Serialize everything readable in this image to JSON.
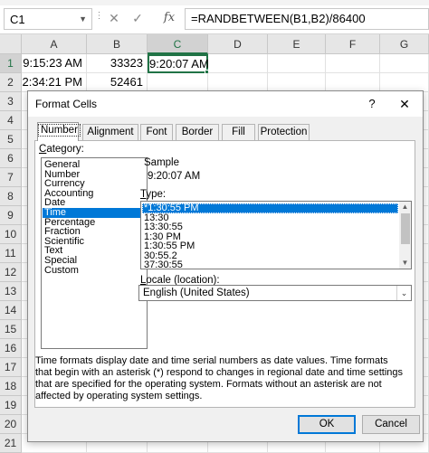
{
  "formula_bar": {
    "name_box": "C1",
    "dots": "⋮",
    "cancel_icon": "✕",
    "enter_icon": "✓",
    "fx_icon": "fx",
    "formula": "=RANDBETWEEN(B1,B2)/86400"
  },
  "sheet": {
    "columns": [
      "A",
      "B",
      "C",
      "D",
      "E",
      "F",
      "G"
    ],
    "active_column": "C",
    "rows": [
      "1",
      "2",
      "3",
      "4",
      "5",
      "6",
      "7",
      "8",
      "9",
      "10",
      "11",
      "12",
      "13",
      "14",
      "15",
      "16",
      "17",
      "18",
      "19",
      "20",
      "21"
    ],
    "active_row": "1",
    "cells": {
      "A1": "9:15:23 AM",
      "B1": "33323",
      "C1": "9:20:07 AM",
      "A2": "2:34:21 PM",
      "B2": "52461"
    },
    "accent_color": "#217346"
  },
  "dialog": {
    "title": "Format Cells",
    "help_label": "?",
    "close_icon": "✕",
    "tabs": [
      "Number",
      "Alignment",
      "Font",
      "Border",
      "Fill",
      "Protection"
    ],
    "active_tab": "Number",
    "category_label_pre": "",
    "category_label_key": "C",
    "category_label_post": "ategory:",
    "categories": [
      "General",
      "Number",
      "Currency",
      "Accounting",
      "Date",
      "Time",
      "Percentage",
      "Fraction",
      "Scientific",
      "Text",
      "Special",
      "Custom"
    ],
    "selected_category": "Time",
    "sample_label": "Sample",
    "sample_value": "9:20:07 AM",
    "type_label_key": "T",
    "type_label_post": "ype:",
    "types": [
      "*1:30:55 PM",
      "13:30",
      "13:30:55",
      "1:30 PM",
      "1:30:55 PM",
      "30:55.2",
      "37:30:55"
    ],
    "selected_type": "*1:30:55 PM",
    "locale_label_key": "L",
    "locale_label_post": "ocale (location):",
    "locale_value": "English (United States)",
    "description": "Time formats display date and time serial numbers as date values.  Time formats that begin with an asterisk (*) respond to changes in regional date and time settings that are specified for the operating system. Formats without an asterisk are not affected by operating system settings.",
    "ok_label": "OK",
    "cancel_label": "Cancel",
    "selection_color": "#0078d7"
  }
}
